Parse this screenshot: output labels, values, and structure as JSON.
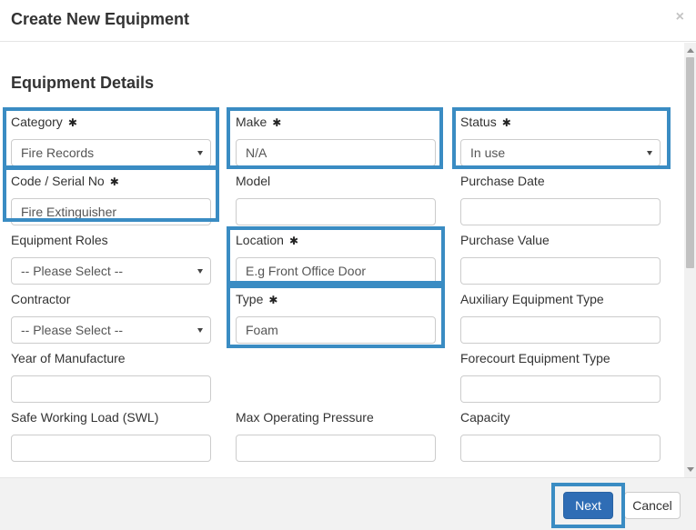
{
  "modal": {
    "title": "Create New Equipment",
    "close_symbol": "×"
  },
  "section": {
    "title": "Equipment Details"
  },
  "required_marker": "✱",
  "fields": {
    "category": {
      "label": "Category",
      "value": "Fire Records",
      "type": "select",
      "required": true
    },
    "make": {
      "label": "Make",
      "value": "N/A",
      "type": "input",
      "required": true
    },
    "status": {
      "label": "Status",
      "value": "In use",
      "type": "select",
      "required": true
    },
    "code_serial": {
      "label": "Code / Serial No",
      "value": "Fire Extinguisher",
      "type": "input",
      "required": true
    },
    "model": {
      "label": "Model",
      "value": "",
      "type": "input"
    },
    "purchase_date": {
      "label": "Purchase Date",
      "value": "",
      "type": "input"
    },
    "equipment_roles": {
      "label": "Equipment Roles",
      "value": "-- Please Select --",
      "type": "select"
    },
    "location": {
      "label": "Location",
      "placeholder": "E.g Front Office Door",
      "type": "input",
      "required": true
    },
    "purchase_value": {
      "label": "Purchase Value",
      "value": "",
      "type": "input"
    },
    "contractor": {
      "label": "Contractor",
      "value": "-- Please Select --",
      "type": "select"
    },
    "type": {
      "label": "Type",
      "value": "Foam",
      "type": "input",
      "required": true
    },
    "auxiliary_equipment_type": {
      "label": "Auxiliary Equipment Type",
      "value": "",
      "type": "input"
    },
    "year_of_manufacture": {
      "label": "Year of Manufacture",
      "value": "",
      "type": "input"
    },
    "forecourt_equipment_type": {
      "label": "Forecourt Equipment Type",
      "value": "",
      "type": "input"
    },
    "safe_working_load": {
      "label": "Safe Working Load (SWL)",
      "value": "",
      "type": "input"
    },
    "max_operating_pressure": {
      "label": "Max Operating Pressure",
      "value": "",
      "type": "input"
    },
    "capacity": {
      "label": "Capacity",
      "value": "",
      "type": "input"
    }
  },
  "footer": {
    "next_label": "Next",
    "cancel_label": "Cancel"
  },
  "colors": {
    "highlight": "#3a8cc3",
    "primary_button": "#2f6db5"
  }
}
